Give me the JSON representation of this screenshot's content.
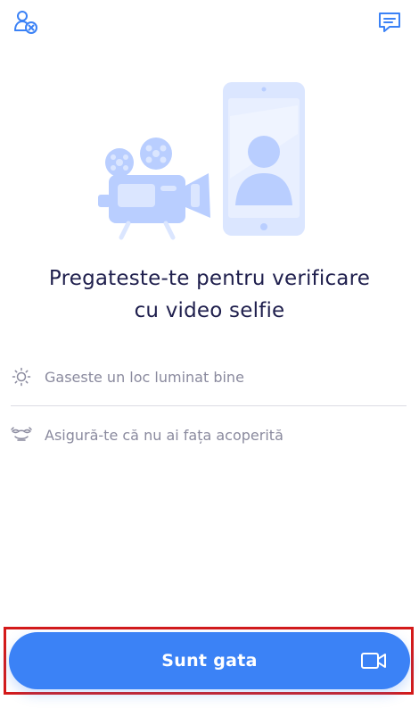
{
  "header": {
    "left_icon": "user-remove-icon",
    "right_icon": "chat-message-icon"
  },
  "illustration": {
    "name": "camera-and-phone-selfie-illustration",
    "color": "#b9ceff"
  },
  "title": {
    "line1": "Pregateste-te pentru verificare",
    "line2": "cu video selfie"
  },
  "tips": [
    {
      "icon": "sun-icon",
      "text": "Gaseste un loc luminat bine"
    },
    {
      "icon": "face-covering-icon",
      "text": "Asigură-te că nu ai fața acoperită"
    }
  ],
  "cta": {
    "label": "Sunt gata",
    "icon": "video-camera-icon",
    "color": "#3b82f6"
  }
}
